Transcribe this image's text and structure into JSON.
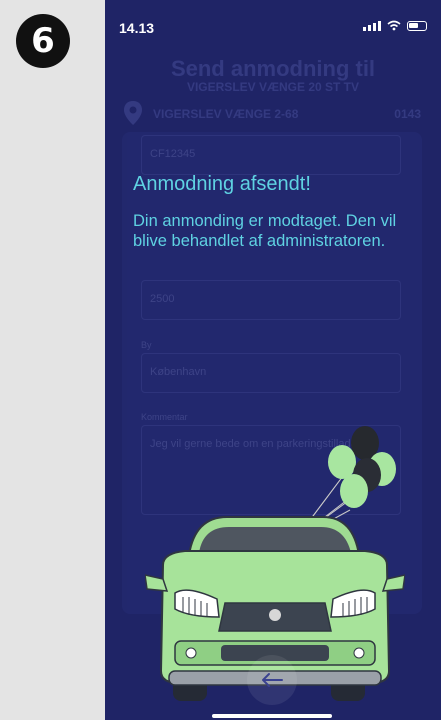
{
  "step_badge": "6",
  "status_bar": {
    "time": "14.13"
  },
  "background_form": {
    "title": "Send anmodning til",
    "subtitle": "VIGERSLEV VÆNGE 20 ST TV",
    "address": "VIGERSLEV VÆNGE 2-68",
    "address_id": "0143",
    "plate_value": "CF12345",
    "postal_value": "2500",
    "city_label": "By",
    "city_value": "København",
    "comment_label": "Kommentar",
    "comment_value": "Jeg vil gerne bede om en parkeringstilladelse"
  },
  "overlay": {
    "title": "Anmodning afsendt!",
    "message": "Din anmonding er modtaget. Den vil blive behandlet af administratoren."
  },
  "colors": {
    "background": "#1f2466",
    "accent_text": "#5fd2e2",
    "car_body": "#a7e39a"
  }
}
